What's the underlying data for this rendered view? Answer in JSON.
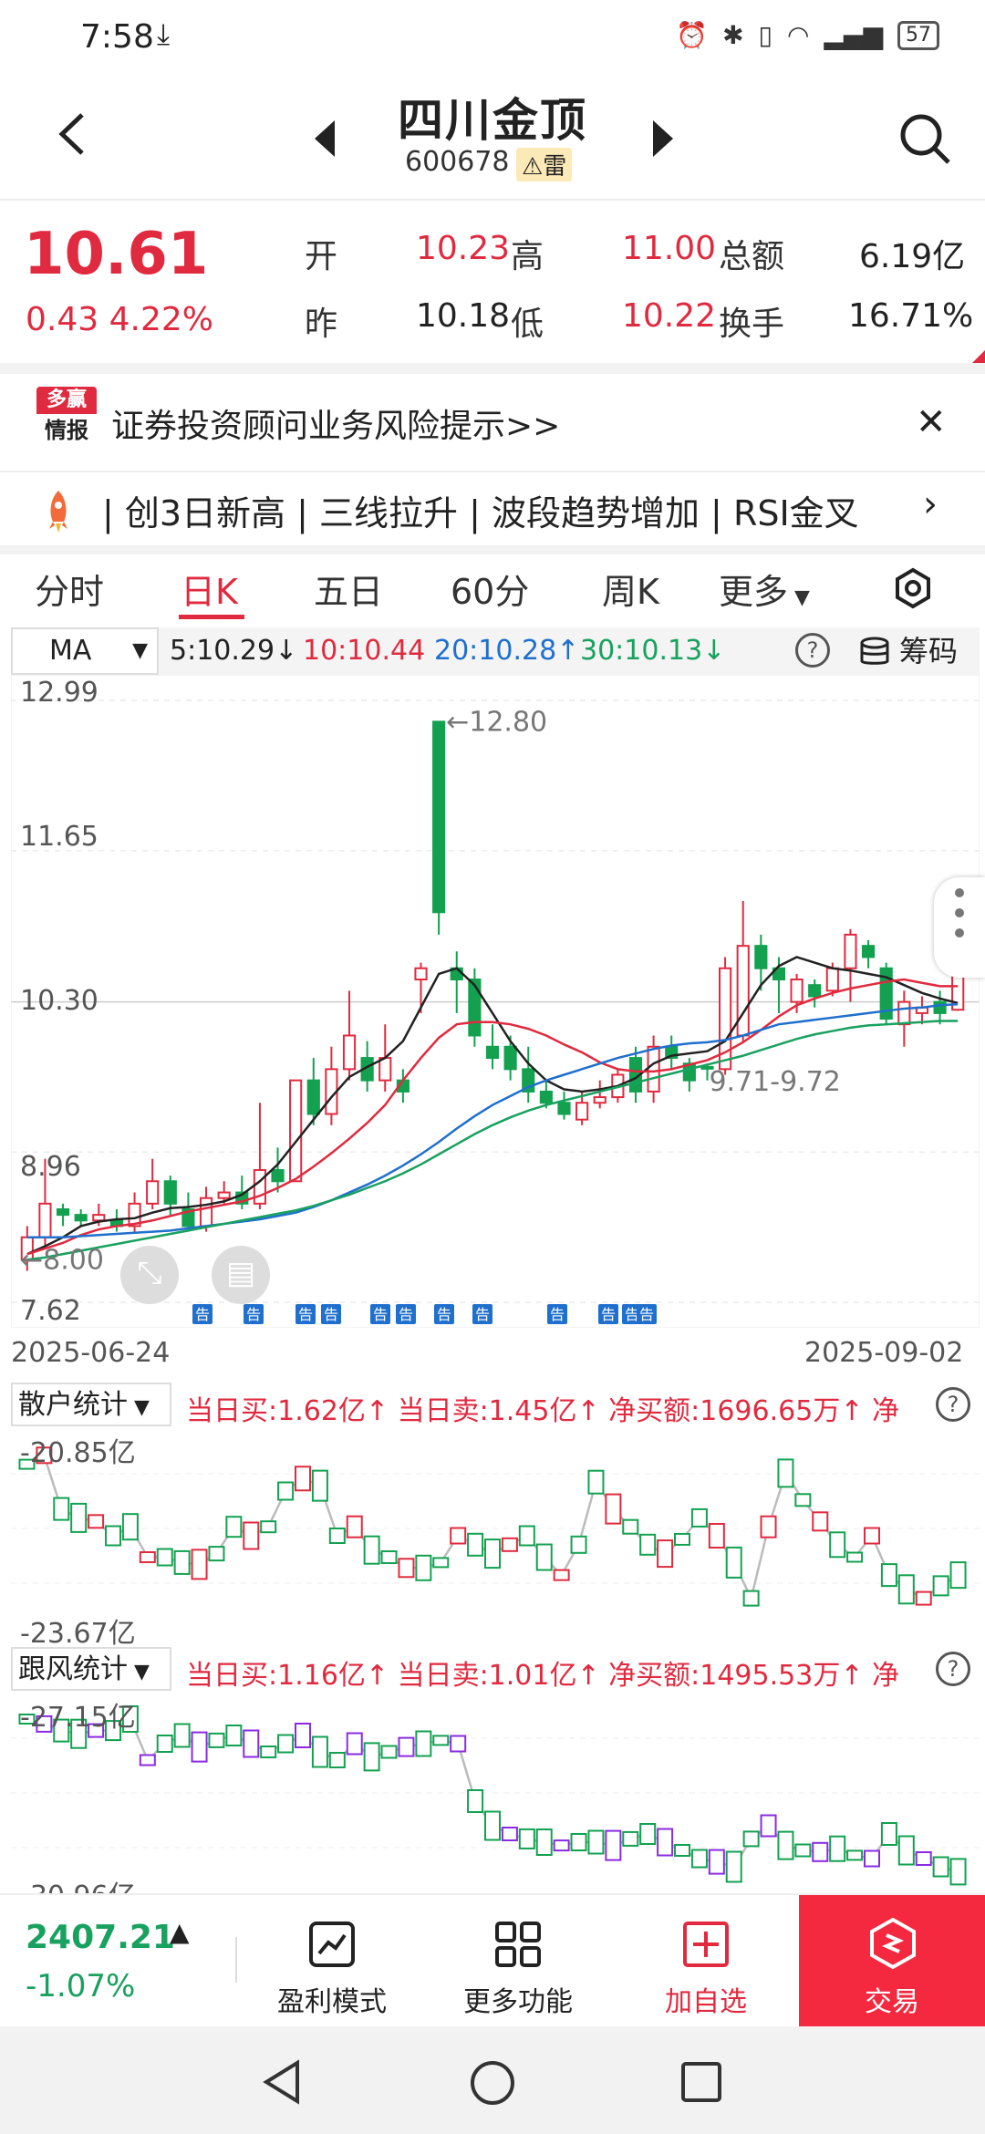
{
  "status": {
    "time": "7:58",
    "battery": "57"
  },
  "header": {
    "stock_name": "四川金顶",
    "stock_code": "600678",
    "risk_tag": "⚠雷"
  },
  "quote": {
    "price": "10.61",
    "change": "0.43 4.22%",
    "open_label": "开",
    "open": "10.23",
    "high_label": "高",
    "high": "11.00",
    "amount_label": "总额",
    "amount": "6.19亿",
    "prev_label": "昨",
    "prev": "10.18",
    "low_label": "低",
    "low": "10.22",
    "turnover_label": "换手",
    "turnover": "16.71%"
  },
  "risk_banner": {
    "logo_top": "多赢",
    "logo_bottom": "情报",
    "text": "证券投资顾问业务风险提示>>"
  },
  "tag_ticker": {
    "text": "| 创3日新高 | 三线拉升 | 波段趋势增加 | RSI金叉"
  },
  "k_tabs": [
    "分时",
    "日K",
    "五日",
    "60分",
    "周K",
    "更多"
  ],
  "ma_bar": {
    "label": "MA",
    "ma5": "5:10.29↓",
    "ma10": "10:10.44",
    "ma20": "20:10.28↑",
    "ma30": "30:10.13↓",
    "chips": "筹码"
  },
  "chart_data": {
    "type": "candlestick",
    "y_axis_labels": [
      "12.99",
      "11.65",
      "10.30",
      "8.96",
      "7.62"
    ],
    "x_axis_labels": [
      "2025-06-24",
      "2025-09-02"
    ],
    "annotations": [
      "12.80",
      "8.00",
      "9.71-9.72"
    ],
    "event_marker": "告",
    "candles": [
      {
        "o": 8.0,
        "c": 8.2,
        "h": 8.3,
        "l": 7.9
      },
      {
        "o": 8.2,
        "c": 8.5,
        "h": 8.9,
        "l": 8.1
      },
      {
        "o": 8.45,
        "c": 8.4,
        "h": 8.5,
        "l": 8.3
      },
      {
        "o": 8.4,
        "c": 8.35,
        "h": 8.45,
        "l": 8.3
      },
      {
        "o": 8.35,
        "c": 8.4,
        "h": 8.5,
        "l": 8.3
      },
      {
        "o": 8.35,
        "c": 8.3,
        "h": 8.45,
        "l": 8.25
      },
      {
        "o": 8.3,
        "c": 8.5,
        "h": 8.6,
        "l": 8.25
      },
      {
        "o": 8.5,
        "c": 8.7,
        "h": 8.9,
        "l": 8.45
      },
      {
        "o": 8.7,
        "c": 8.5,
        "h": 8.75,
        "l": 8.4
      },
      {
        "o": 8.45,
        "c": 8.3,
        "h": 8.6,
        "l": 8.25
      },
      {
        "o": 8.3,
        "c": 8.55,
        "h": 8.65,
        "l": 8.25
      },
      {
        "o": 8.55,
        "c": 8.6,
        "h": 8.7,
        "l": 8.5
      },
      {
        "o": 8.6,
        "c": 8.5,
        "h": 8.75,
        "l": 8.45
      },
      {
        "o": 8.5,
        "c": 8.8,
        "h": 9.4,
        "l": 8.45
      },
      {
        "o": 8.8,
        "c": 8.7,
        "h": 9.0,
        "l": 8.6
      },
      {
        "o": 8.7,
        "c": 9.6,
        "h": 9.6,
        "l": 8.7
      },
      {
        "o": 9.6,
        "c": 9.3,
        "h": 9.8,
        "l": 9.2
      },
      {
        "o": 9.3,
        "c": 9.7,
        "h": 9.9,
        "l": 9.2
      },
      {
        "o": 9.7,
        "c": 10.0,
        "h": 10.4,
        "l": 9.6
      },
      {
        "o": 9.8,
        "c": 9.6,
        "h": 9.95,
        "l": 9.5
      },
      {
        "o": 9.6,
        "c": 9.8,
        "h": 10.1,
        "l": 9.5
      },
      {
        "o": 9.6,
        "c": 9.5,
        "h": 9.7,
        "l": 9.4
      },
      {
        "o": 10.5,
        "c": 10.6,
        "h": 10.65,
        "l": 10.2
      },
      {
        "o": 12.8,
        "c": 11.1,
        "h": 12.8,
        "l": 10.9
      },
      {
        "o": 10.6,
        "c": 10.5,
        "h": 10.75,
        "l": 10.2
      },
      {
        "o": 10.5,
        "c": 10.0,
        "h": 10.6,
        "l": 9.9
      },
      {
        "o": 9.9,
        "c": 9.8,
        "h": 10.1,
        "l": 9.7
      },
      {
        "o": 9.9,
        "c": 9.7,
        "h": 10.0,
        "l": 9.6
      },
      {
        "o": 9.7,
        "c": 9.5,
        "h": 9.9,
        "l": 9.4
      },
      {
        "o": 9.5,
        "c": 9.4,
        "h": 9.6,
        "l": 9.35
      },
      {
        "o": 9.4,
        "c": 9.3,
        "h": 9.5,
        "l": 9.25
      },
      {
        "o": 9.25,
        "c": 9.4,
        "h": 9.5,
        "l": 9.2
      },
      {
        "o": 9.4,
        "c": 9.45,
        "h": 9.6,
        "l": 9.35
      },
      {
        "o": 9.45,
        "c": 9.65,
        "h": 9.7,
        "l": 9.4
      },
      {
        "o": 9.8,
        "c": 9.5,
        "h": 9.9,
        "l": 9.4
      },
      {
        "o": 9.5,
        "c": 9.9,
        "h": 10.0,
        "l": 9.4
      },
      {
        "o": 9.9,
        "c": 9.8,
        "h": 10.0,
        "l": 9.7
      },
      {
        "o": 9.75,
        "c": 9.6,
        "h": 9.8,
        "l": 9.5
      },
      {
        "o": 9.72,
        "c": 9.71,
        "h": 9.75,
        "l": 9.6
      },
      {
        "o": 9.7,
        "c": 10.6,
        "h": 10.7,
        "l": 9.65
      },
      {
        "o": 10.0,
        "c": 10.8,
        "h": 11.2,
        "l": 9.95
      },
      {
        "o": 10.8,
        "c": 10.6,
        "h": 10.9,
        "l": 10.4
      },
      {
        "o": 10.6,
        "c": 10.5,
        "h": 10.7,
        "l": 10.2
      },
      {
        "o": 10.3,
        "c": 10.5,
        "h": 10.55,
        "l": 10.2
      },
      {
        "o": 10.45,
        "c": 10.35,
        "h": 10.5,
        "l": 10.25
      },
      {
        "o": 10.4,
        "c": 10.6,
        "h": 10.65,
        "l": 10.35
      },
      {
        "o": 10.6,
        "c": 10.9,
        "h": 10.95,
        "l": 10.3
      },
      {
        "o": 10.8,
        "c": 10.7,
        "h": 10.85,
        "l": 10.6
      },
      {
        "o": 10.6,
        "c": 10.15,
        "h": 10.65,
        "l": 10.1
      },
      {
        "o": 10.1,
        "c": 10.3,
        "h": 10.4,
        "l": 9.9
      },
      {
        "o": 10.2,
        "c": 10.25,
        "h": 10.35,
        "l": 10.1
      },
      {
        "o": 10.3,
        "c": 10.2,
        "h": 10.4,
        "l": 10.1
      },
      {
        "o": 10.23,
        "c": 10.61,
        "h": 11.0,
        "l": 10.22
      }
    ],
    "series": [
      {
        "name": "MA5",
        "color": "#222222",
        "values": [
          8.05,
          8.12,
          8.2,
          8.3,
          8.34,
          8.36,
          8.37,
          8.42,
          8.46,
          8.47,
          8.49,
          8.52,
          8.58,
          8.7,
          8.85,
          9.05,
          9.25,
          9.45,
          9.63,
          9.72,
          9.8,
          9.95,
          10.25,
          10.55,
          10.6,
          10.45,
          10.2,
          9.95,
          9.75,
          9.6,
          9.52,
          9.5,
          9.52,
          9.55,
          9.62,
          9.75,
          9.82,
          9.84,
          9.86,
          9.95,
          10.2,
          10.45,
          10.62,
          10.7,
          10.65,
          10.6,
          10.58,
          10.55,
          10.52,
          10.45,
          10.38,
          10.33,
          10.29
        ]
      },
      {
        "name": "MA10",
        "color": "#e02a3f",
        "values": [
          8.05,
          8.1,
          8.15,
          8.22,
          8.27,
          8.3,
          8.32,
          8.35,
          8.39,
          8.43,
          8.46,
          8.49,
          8.52,
          8.57,
          8.64,
          8.72,
          8.83,
          8.95,
          9.08,
          9.22,
          9.38,
          9.6,
          9.8,
          9.98,
          10.1,
          10.12,
          10.12,
          10.1,
          10.06,
          10.0,
          9.92,
          9.85,
          9.76,
          9.7,
          9.68,
          9.68,
          9.7,
          9.74,
          9.78,
          9.85,
          9.94,
          10.05,
          10.17,
          10.27,
          10.33,
          10.38,
          10.42,
          10.45,
          10.48,
          10.5,
          10.47,
          10.44,
          10.44
        ]
      },
      {
        "name": "MA20",
        "color": "#1f6fce",
        "values": [
          8.2,
          8.2,
          8.2,
          8.21,
          8.22,
          8.23,
          8.24,
          8.25,
          8.26,
          8.28,
          8.3,
          8.32,
          8.34,
          8.36,
          8.39,
          8.42,
          8.47,
          8.53,
          8.6,
          8.67,
          8.75,
          8.84,
          8.94,
          9.05,
          9.17,
          9.28,
          9.38,
          9.46,
          9.54,
          9.6,
          9.65,
          9.7,
          9.75,
          9.8,
          9.84,
          9.88,
          9.91,
          9.93,
          9.94,
          9.96,
          10.0,
          10.05,
          10.1,
          10.12,
          10.14,
          10.16,
          10.18,
          10.2,
          10.22,
          10.24,
          10.25,
          10.27,
          10.28
        ]
      },
      {
        "name": "MA30",
        "color": "#19a15f",
        "values": [
          8.0,
          8.02,
          8.05,
          8.08,
          8.11,
          8.14,
          8.17,
          8.2,
          8.23,
          8.26,
          8.29,
          8.32,
          8.35,
          8.38,
          8.41,
          8.44,
          8.48,
          8.53,
          8.58,
          8.64,
          8.7,
          8.77,
          8.85,
          8.94,
          9.03,
          9.12,
          9.2,
          9.27,
          9.33,
          9.38,
          9.42,
          9.46,
          9.5,
          9.54,
          9.58,
          9.62,
          9.66,
          9.7,
          9.74,
          9.78,
          9.82,
          9.87,
          9.92,
          9.97,
          10.01,
          10.04,
          10.07,
          10.09,
          10.1,
          10.11,
          10.12,
          10.13,
          10.13
        ]
      }
    ],
    "ylim": [
      7.62,
      12.99
    ]
  },
  "retail": {
    "label": "散户统计",
    "stats": "当日买:1.62亿↑ 当日卖:1.45亿↑ 净买额:1696.65万↑ 净",
    "y_top": "-20.85亿",
    "y_bottom": "-23.67亿"
  },
  "follow": {
    "label": "跟风统计",
    "stats": "当日买:1.16亿↑ 当日卖:1.01亿↑ 净买额:1495.53万↑ 净",
    "y_top": "-27.15亿",
    "y_bottom": "-30.96亿"
  },
  "bottom_bar": {
    "index_value": "2407.21",
    "index_change": "-1.07%",
    "nav": [
      {
        "label": "盈利模式"
      },
      {
        "label": "更多功能"
      },
      {
        "label": "加自选"
      }
    ],
    "trade": "交易"
  }
}
